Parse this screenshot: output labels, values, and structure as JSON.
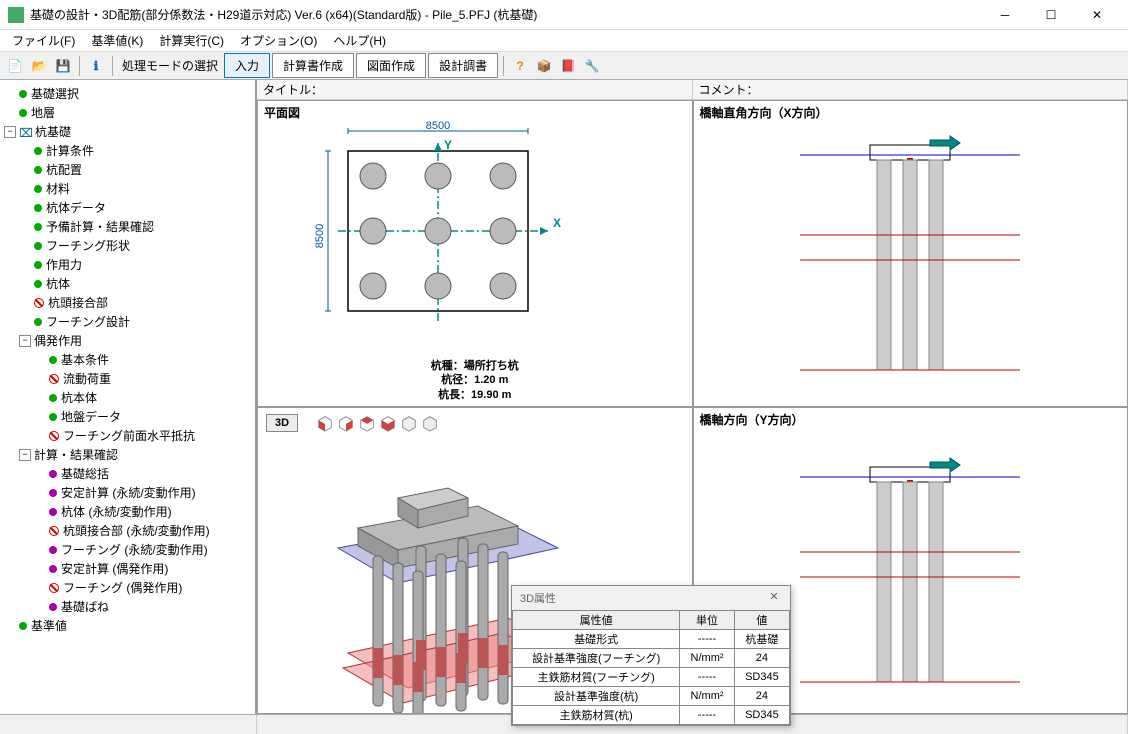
{
  "window": {
    "title": "基礎の設計・3D配筋(部分係数法・H29道示対応) Ver.6 (x64)(Standard版) - Pile_5.PFJ (杭基礎)"
  },
  "menu": {
    "file": "ファイル(F)",
    "std": "基準値(K)",
    "calc": "計算実行(C)",
    "option": "オプション(O)",
    "help": "ヘルプ(H)"
  },
  "toolbar": {
    "mode_select": "処理モードの選択",
    "input": "入力",
    "report": "計算書作成",
    "drawing": "図面作成",
    "design_report": "設計調書"
  },
  "tree": {
    "n1": "基礎選択",
    "n2": "地層",
    "n3": "杭基礎",
    "n3_1": "計算条件",
    "n3_2": "杭配置",
    "n3_3": "材料",
    "n3_4": "杭体データ",
    "n3_5": "予備計算・結果確認",
    "n3_6": "フーチング形状",
    "n3_7": "作用力",
    "n3_8": "杭体",
    "n3_9": "杭頭接合部",
    "n3_10": "フーチング設計",
    "n3_11": "偶発作用",
    "n3_11_1": "基本条件",
    "n3_11_2": "流動荷重",
    "n3_11_3": "杭本体",
    "n3_11_4": "地盤データ",
    "n3_11_5": "フーチング前面水平抵抗",
    "n3_12": "計算・結果確認",
    "n3_12_1": "基礎総括",
    "n3_12_2": "安定計算 (永続/変動作用)",
    "n3_12_3": "杭体 (永続/変動作用)",
    "n3_12_4": "杭頭接合部 (永続/変動作用)",
    "n3_12_5": "フーチング (永続/変動作用)",
    "n3_12_6": "安定計算 (偶発作用)",
    "n3_12_7": "フーチング (偶発作用)",
    "n3_12_8": "基礎ばね",
    "n4": "基準値"
  },
  "header": {
    "title_label": "タイトル：",
    "comment_label": "コメント："
  },
  "views": {
    "plan": "平面図",
    "plan_dim_w": "8500",
    "plan_dim_h": "8500",
    "plan_info1": "杭種：場所打ち杭",
    "plan_info2": "杭径：1.20 m",
    "plan_info3": "杭長：19.90 m",
    "x_view": "橋軸直角方向（X方向）",
    "y_view": "橋軸方向（Y方向）",
    "btn_3d": "3D"
  },
  "panel": {
    "title": "3D属性",
    "col1": "属性値",
    "col2": "単位",
    "col3": "値",
    "rows": [
      {
        "a": "基礎形式",
        "u": "-----",
        "v": "杭基礎"
      },
      {
        "a": "設計基準強度(フーチング)",
        "u": "N/mm²",
        "v": "24"
      },
      {
        "a": "主鉄筋材質(フーチング)",
        "u": "-----",
        "v": "SD345"
      },
      {
        "a": "設計基準強度(杭)",
        "u": "N/mm²",
        "v": "24"
      },
      {
        "a": "主鉄筋材質(杭)",
        "u": "-----",
        "v": "SD345"
      }
    ]
  }
}
